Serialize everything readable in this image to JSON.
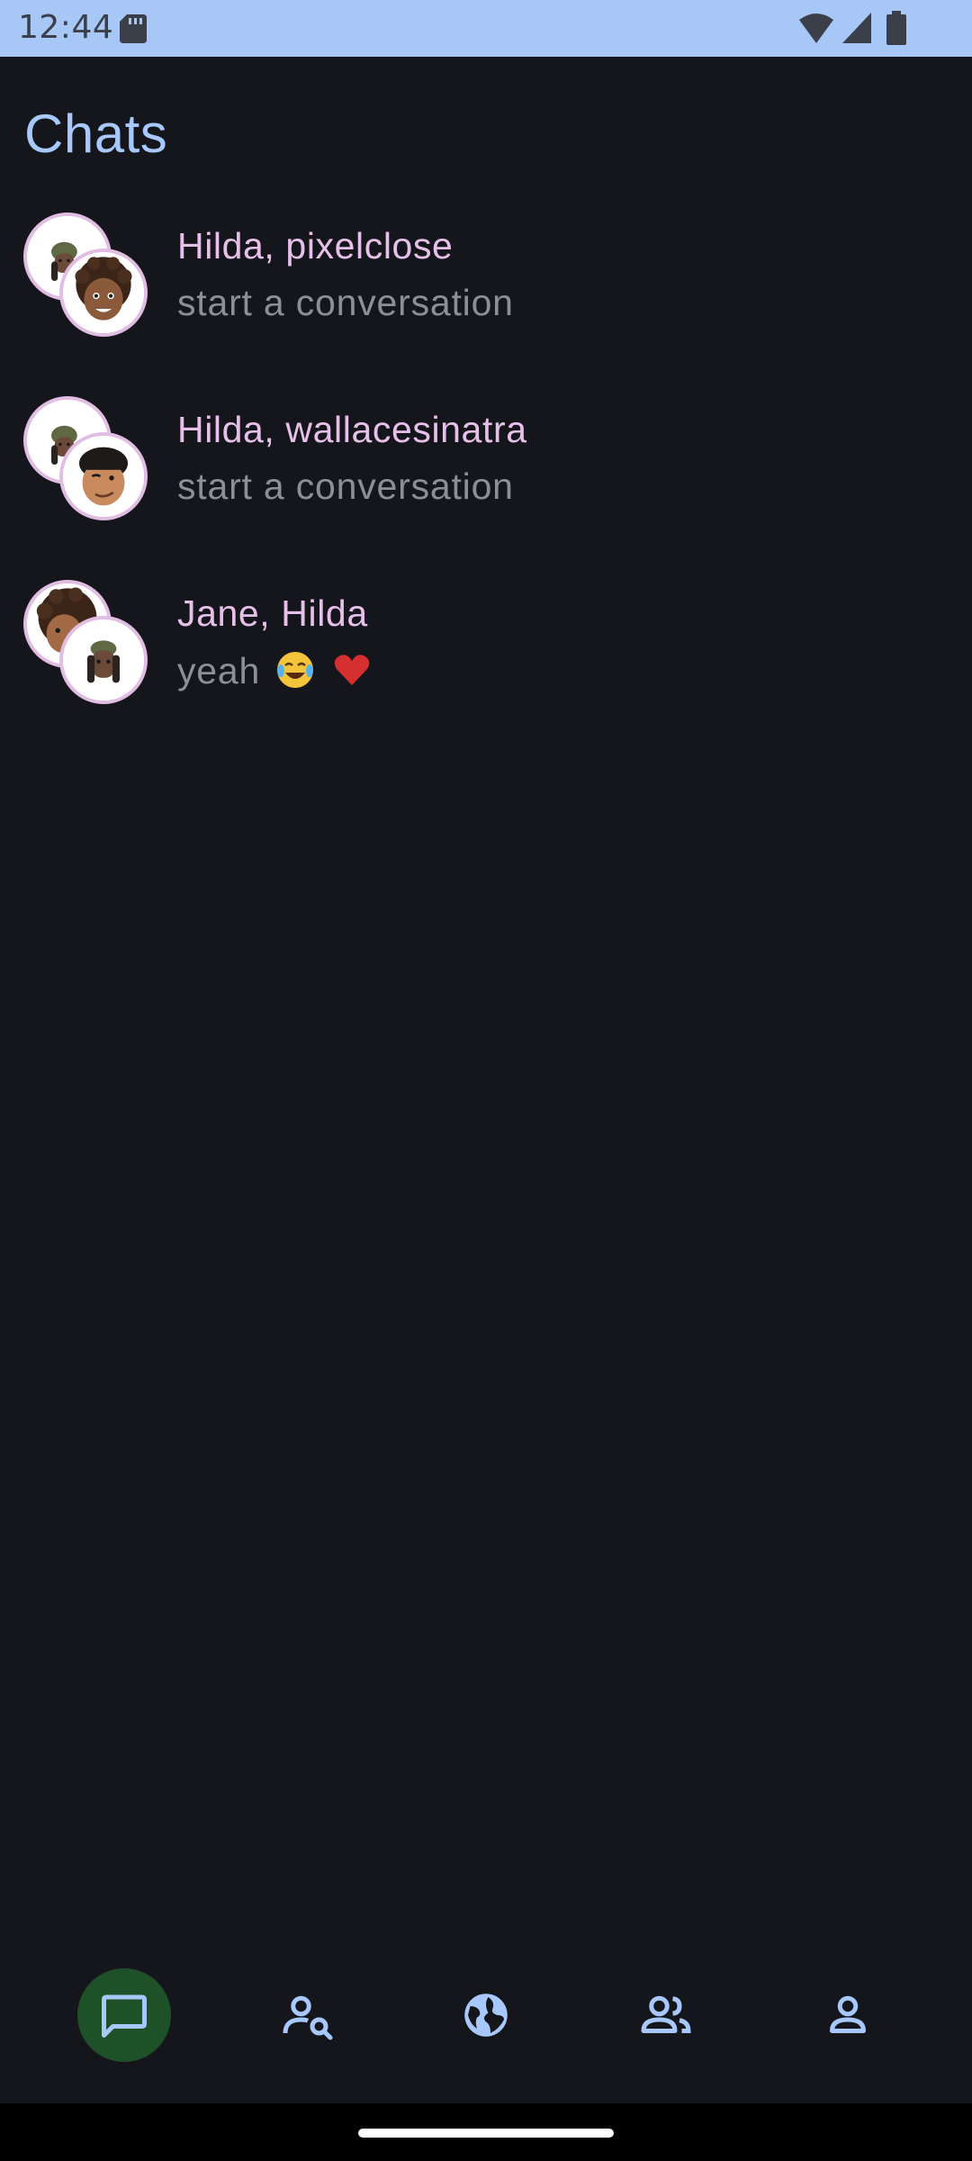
{
  "status_bar": {
    "time": "12:44",
    "icons": [
      "sd-card-icon",
      "wifi-icon",
      "cell-signal-icon",
      "battery-icon"
    ]
  },
  "page_title": "Chats",
  "chats": [
    {
      "name": "Hilda, pixelclose",
      "preview": "start a conversation",
      "avatars": [
        "memoji-hilda",
        "memoji-pixelclose"
      ]
    },
    {
      "name": "Hilda, wallacesinatra",
      "preview": "start a conversation",
      "avatars": [
        "memoji-hilda",
        "memoji-wallacesinatra"
      ]
    },
    {
      "name": "Jane, Hilda",
      "preview": "yeah",
      "preview_emojis": [
        "tears-of-joy-emoji",
        "red-heart-emoji"
      ],
      "avatars": [
        "memoji-jane",
        "memoji-hilda"
      ]
    }
  ],
  "bottom_nav": {
    "items": [
      {
        "icon": "chat-icon",
        "active": true
      },
      {
        "icon": "search-person-icon",
        "active": false
      },
      {
        "icon": "globe-icon",
        "active": false
      },
      {
        "icon": "people-icon",
        "active": false
      },
      {
        "icon": "profile-icon",
        "active": false
      }
    ]
  },
  "colors": {
    "background": "#14161c",
    "status_bar": "#a7c8f7",
    "title": "#a6c8fc",
    "chat_name": "#e7c0ea",
    "preview": "#8d8f95",
    "avatar_ring": "#e1bde4",
    "nav_active": "#1f5129",
    "nav_icon": "#a6c8fc"
  }
}
